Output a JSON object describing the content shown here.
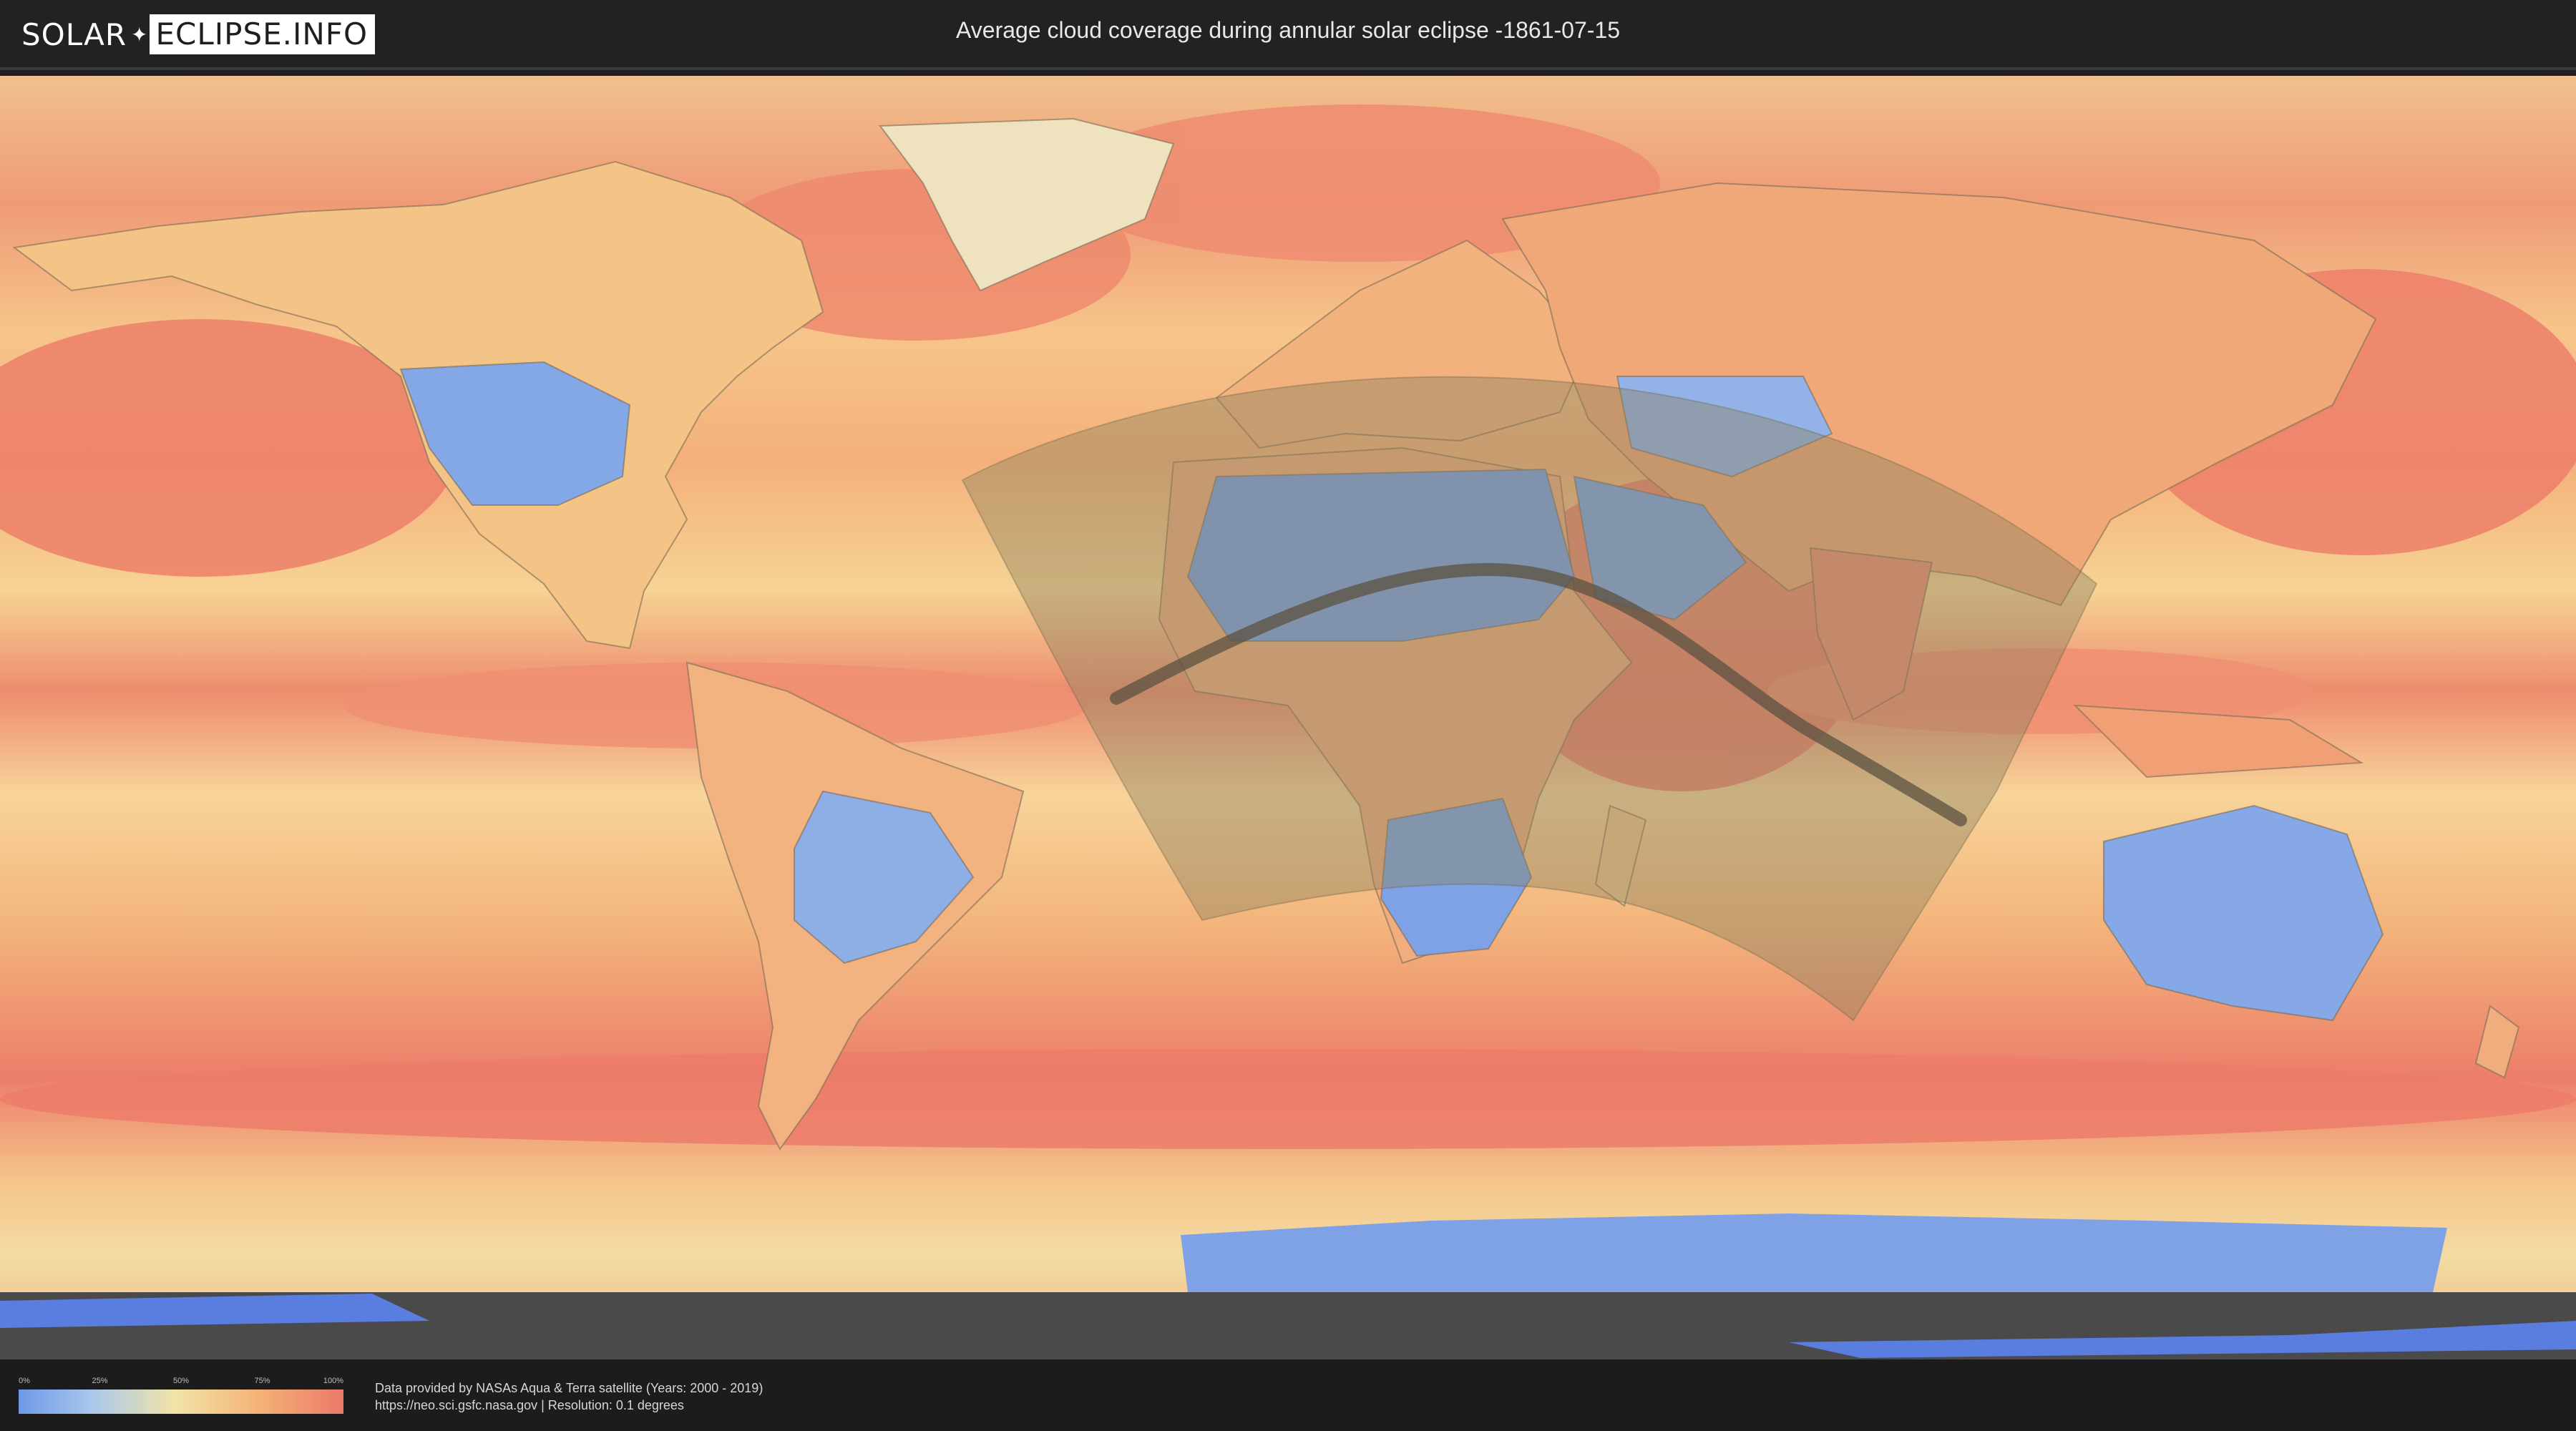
{
  "header": {
    "logo_part_a": "SOLAR",
    "logo_part_b": "ECLIPSE.INFO",
    "title": "Average cloud coverage during annular solar eclipse -1861-07-15"
  },
  "legend": {
    "ticks": [
      "0%",
      "25%",
      "50%",
      "75%",
      "100%"
    ],
    "colors": [
      "#6f99e8",
      "#a7c6ec",
      "#f2e4a8",
      "#f4b276",
      "#ec7a6a"
    ]
  },
  "credits": {
    "line1": "Data provided by NASAs Aqua & Terra satellite (Years: 2000 - 2019)",
    "line2": "https://neo.sci.gsfc.nasa.gov | Resolution: 0.1 degrees"
  },
  "map": {
    "ocean_cloud_color": "#ec8a6c",
    "clear_land_color": "#7ea2e6",
    "antarctica_shadow_color": "#4a4a4a",
    "eclipse_region_fill": "#8a8060",
    "eclipse_path_color": "#5b5240"
  }
}
